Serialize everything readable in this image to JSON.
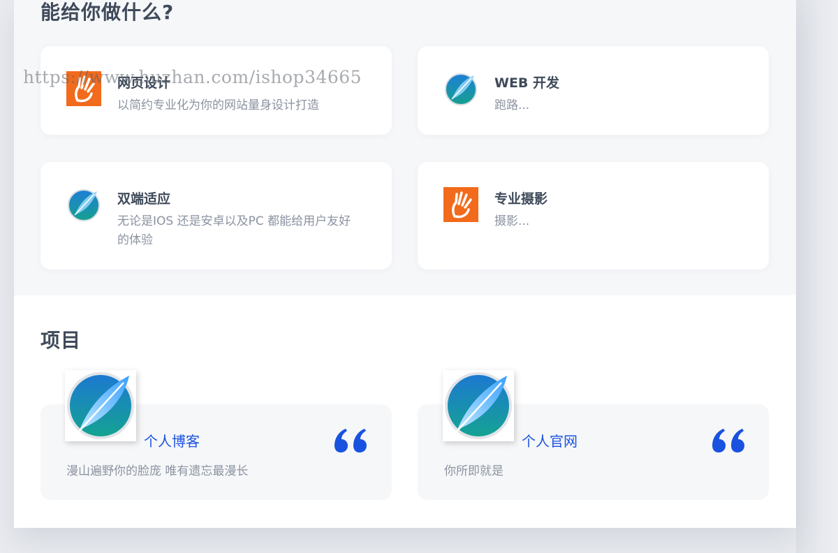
{
  "services": {
    "heading": "能给你做什么?",
    "items": [
      {
        "title": "网页设计",
        "desc": "以简约专业化为你的网站量身设计打造",
        "icon": "hand-icon"
      },
      {
        "title": "WEB 开发",
        "desc": "跑路...",
        "icon": "feather-icon"
      },
      {
        "title": "双端适应",
        "desc": "无论是IOS 还是安卓以及PC 都能给用户友好的体验",
        "icon": "feather-icon"
      },
      {
        "title": "专业摄影",
        "desc": "摄影...",
        "icon": "hand-icon"
      }
    ]
  },
  "projects": {
    "heading": "项目",
    "items": [
      {
        "name": "个人博客",
        "desc": "漫山遍野你的脸庞 唯有遗忘最漫长"
      },
      {
        "name": "个人官网",
        "desc": "你所即就是"
      }
    ]
  },
  "watermark": "https://www.huzhan.com/ishop34665",
  "colors": {
    "accent": "#1a52e0",
    "hand_icon_bg": "#f26a1b",
    "title": "#3f4a5a",
    "muted": "#8b93a1"
  }
}
